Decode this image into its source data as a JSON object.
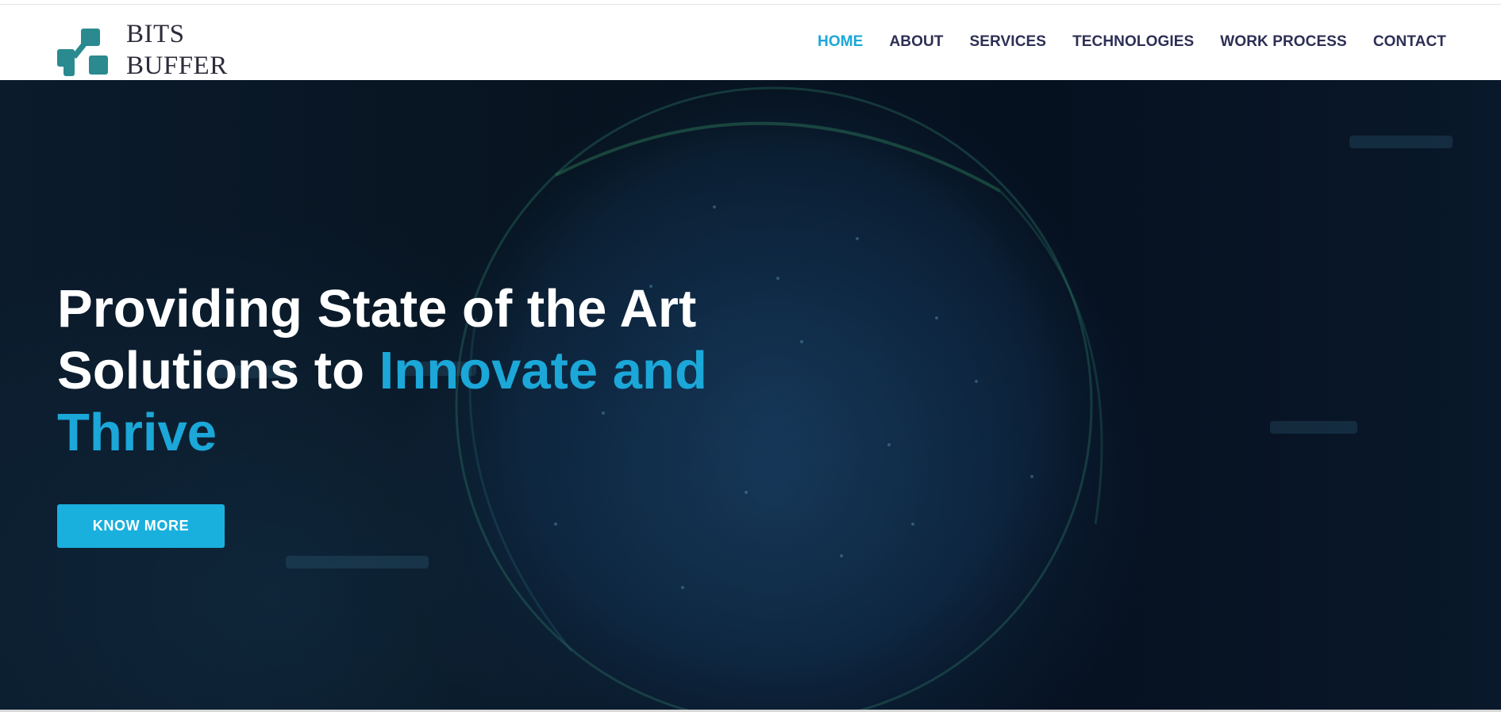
{
  "brand": {
    "line1": "BITS",
    "line2": "BUFFER",
    "logo_icon": "bits-buffer-logo-icon",
    "color": "#2a8a8f"
  },
  "nav": {
    "items": [
      {
        "label": "HOME",
        "active": true
      },
      {
        "label": "ABOUT",
        "active": false
      },
      {
        "label": "SERVICES",
        "active": false
      },
      {
        "label": "TECHNOLOGIES",
        "active": false
      },
      {
        "label": "WORK PROCESS",
        "active": false
      },
      {
        "label": "CONTACT",
        "active": false
      }
    ],
    "active_color": "#1ba7d8",
    "text_color": "#2d2f55"
  },
  "hero": {
    "title_plain_1": "Providing State of the Art",
    "title_plain_2": "Solutions to ",
    "title_accent_1": "Innovate and",
    "title_accent_2": "Thrive",
    "cta_label": "KNOW MORE",
    "background": "globe-network-video",
    "accent_color": "#1ba7d8"
  }
}
